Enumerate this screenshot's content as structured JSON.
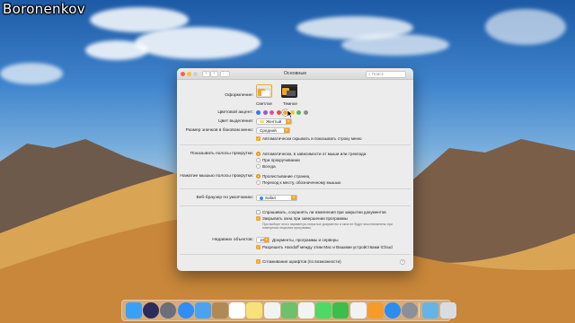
{
  "watermark": "Boronenkov",
  "window": {
    "title": "Основные",
    "search_placeholder": "Поиск"
  },
  "appearance": {
    "label": "Оформление:",
    "options": [
      {
        "label": "Светлое"
      },
      {
        "label": "Темное"
      }
    ],
    "selected": "Светлое"
  },
  "accent": {
    "label": "Цветовой акцент:",
    "colors": [
      "#2f7bf5",
      "#9b59d0",
      "#e4508f",
      "#eb4a4a",
      "#f5a623",
      "#f3c623",
      "#59b84a",
      "#8e8e93"
    ],
    "selected": "#f5a623"
  },
  "highlight": {
    "label": "Цвет выделения:",
    "value": "Желтый"
  },
  "sidebar_size": {
    "label": "Размер значков в боковом меню:",
    "value": "Средний"
  },
  "menubar_autohide": {
    "label": "Автоматически скрывать и показывать строку меню",
    "checked": true
  },
  "scrollbars": {
    "label": "Показывать полосы прокрутки:",
    "options": [
      "Автоматически, в зависимости от мыши или трекпада",
      "При прокручивании",
      "Всегда"
    ],
    "selected": "Автоматически, в зависимости от мыши или трекпада"
  },
  "scroll_click": {
    "label": "Нажатие мышью полосы прокрутки:",
    "options": [
      "Пролистывание страниц",
      "Переход к месту, обозначенному мышью"
    ],
    "selected": "Пролистывание страниц"
  },
  "browser": {
    "label": "Веб-браузер по умолчанию:",
    "value": "Safari"
  },
  "documents": {
    "ask_save": {
      "label": "Спрашивать, сохранять ли изменения при закрытии документов",
      "checked": false
    },
    "close_windows": {
      "label": "Закрывать окна при завершении программы",
      "checked": true
    },
    "note": "При выборе этого параметра открытые документы и окна не будут восстановлены при повторном открытии программы."
  },
  "recent": {
    "label": "Недавних объектов:",
    "value": "10",
    "suffix": "Документы, программы и серверы"
  },
  "handoff": {
    "label": "Разрешить Handoff между этим Mac и Вашими устройствами iCloud",
    "checked": true
  },
  "font_smoothing": {
    "label": "Сглаживание шрифтов (по возможности)",
    "checked": true
  },
  "help": "?",
  "dock_icons": [
    {
      "name": "finder-icon",
      "color": "#3aa0f5"
    },
    {
      "name": "siri-icon",
      "color": "#2b2b5e"
    },
    {
      "name": "launchpad-icon",
      "color": "#6a6f7b"
    },
    {
      "name": "safari-icon",
      "color": "#2f8df5"
    },
    {
      "name": "mail-icon",
      "color": "#4aa3f0"
    },
    {
      "name": "contacts-icon",
      "color": "#b08a55"
    },
    {
      "name": "calendar-icon",
      "color": "#ffffff"
    },
    {
      "name": "notes-icon",
      "color": "#f7e27a"
    },
    {
      "name": "reminders-icon",
      "color": "#f2f2f2"
    },
    {
      "name": "maps-icon",
      "color": "#6cc16a"
    },
    {
      "name": "photos-icon",
      "color": "#f3f3f3"
    },
    {
      "name": "messages-icon",
      "color": "#4cd964"
    },
    {
      "name": "facetime-icon",
      "color": "#3dbd4c"
    },
    {
      "name": "itunes-icon",
      "color": "#f2f2f2"
    },
    {
      "name": "ibooks-icon",
      "color": "#f59b2b"
    },
    {
      "name": "app-store-icon",
      "color": "#2d8cf0"
    },
    {
      "name": "system-preferences-icon",
      "color": "#8a8f98"
    },
    {
      "name": "downloads-folder-icon",
      "color": "#64b4e8"
    },
    {
      "name": "trash-icon",
      "color": "#d9dde2"
    }
  ]
}
